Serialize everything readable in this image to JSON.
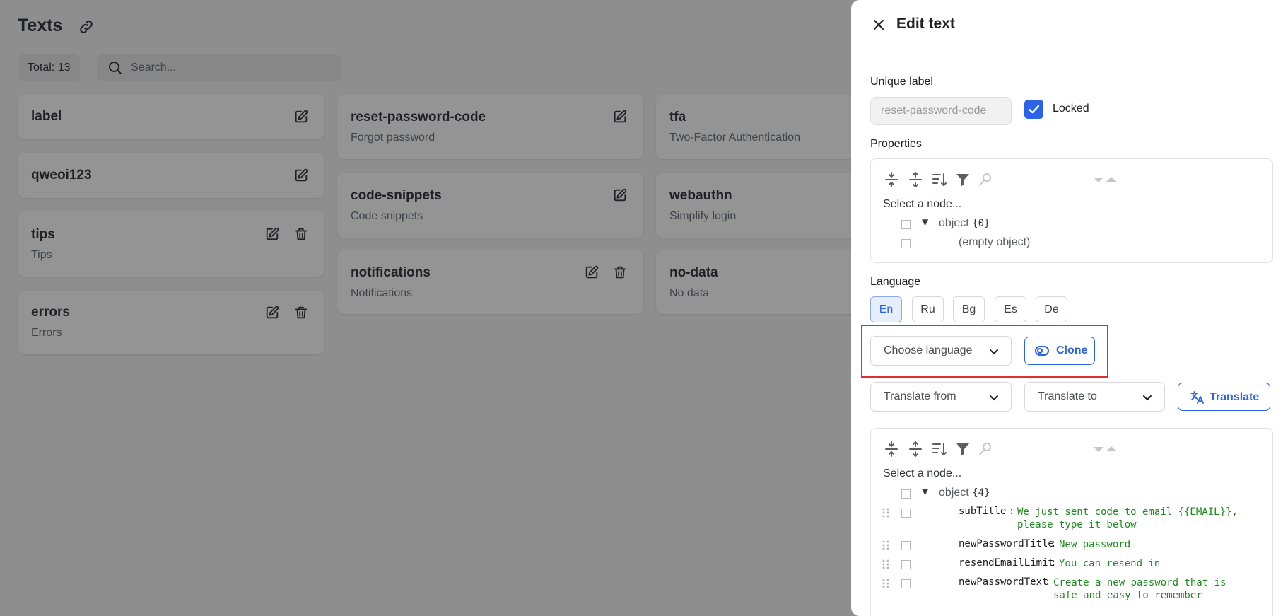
{
  "page": {
    "title": "Texts",
    "total": "Total: 13",
    "search_placeholder": "Search..."
  },
  "cards": {
    "label": {
      "title": "label"
    },
    "qweoi123": {
      "title": "qweoi123"
    },
    "tips": {
      "title": "tips",
      "subtitle": "Tips"
    },
    "errors": {
      "title": "errors",
      "subtitle": "Errors"
    },
    "reset_password_code": {
      "title": "reset-password-code",
      "subtitle": "Forgot password"
    },
    "code_snippets": {
      "title": "code-snippets",
      "subtitle": "Code snippets"
    },
    "notifications": {
      "title": "notifications",
      "subtitle": "Notifications"
    },
    "tfa": {
      "title": "tfa",
      "subtitle": "Two-Factor Authentication"
    },
    "webauthn": {
      "title": "webauthn",
      "subtitle": "Simplify login"
    },
    "no_data": {
      "title": "no-data",
      "subtitle": "No data"
    }
  },
  "drawer": {
    "title": "Edit text",
    "unique_label": "Unique label",
    "unique_label_value": "reset-password-code",
    "locked_label": "Locked",
    "locked": true,
    "properties_label": "Properties",
    "properties_editor": {
      "select_node": "Select a node...",
      "root_type": "object",
      "root_count": "{0}",
      "empty_text": "(empty object)"
    },
    "language_label": "Language",
    "languages": [
      "En",
      "Ru",
      "Bg",
      "Es",
      "De"
    ],
    "active_language": "En",
    "choose_language": "Choose language",
    "clone_label": "Clone",
    "translate_from": "Translate from",
    "translate_to": "Translate to",
    "translate_label": "Translate",
    "content_editor": {
      "select_node": "Select a node...",
      "root_type": "object",
      "root_count": "{4}",
      "entries": [
        {
          "key": "subTitle",
          "value_line1": "We just sent code to email {{EMAIL}},",
          "value_line2": "please type it below"
        },
        {
          "key": "newPasswordTitle",
          "value_line1": "New password"
        },
        {
          "key": "resendEmailLimit",
          "value_line1": "You can resend in"
        },
        {
          "key": "newPasswordText",
          "value_line1": "Create a new password that is",
          "value_line2": "safe and easy to remember"
        }
      ]
    }
  },
  "colors": {
    "accent": "#2b63e6",
    "overlay": "#8e8e8e",
    "highlight": "#e0302b",
    "json_value": "#1e8a1e"
  }
}
